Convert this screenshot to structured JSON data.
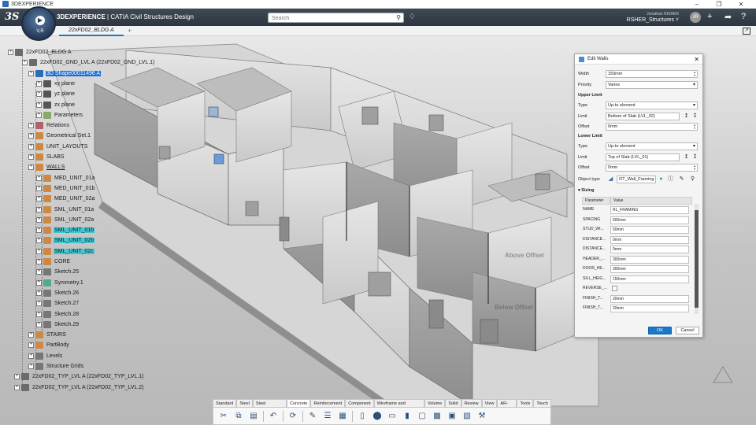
{
  "window": {
    "title": "3DEXPERIENCE",
    "minimize": "–",
    "maximize": "❐",
    "close": "✕"
  },
  "header": {
    "brand_prefix": "3DEXPERIENCE",
    "brand_suffix": " | CATIA Civil Structures Design",
    "search_placeholder": "Search",
    "user_name": "Jonathan RISHER",
    "space": "RSHER_Structures ˅",
    "avatar": "JR",
    "compass_label": "V,R"
  },
  "tabs": {
    "active": "22xFD02_BLDG A",
    "plus": "+"
  },
  "tree": [
    {
      "label": "22xFD02_BLDG A",
      "style": ""
    },
    {
      "label": "22xFD02_GND_LVL A (22xFD02_GND_LVL.1)",
      "style": ""
    },
    {
      "label": "3D Shape00011496 A",
      "style": "sel"
    },
    {
      "label": "xy plane",
      "style": ""
    },
    {
      "label": "yz plane",
      "style": ""
    },
    {
      "label": "zx plane",
      "style": ""
    },
    {
      "label": "Parameters",
      "style": ""
    },
    {
      "label": "Relations",
      "style": ""
    },
    {
      "label": "Geometrical Set.1",
      "style": ""
    },
    {
      "label": "UNIT_LAYOUTS",
      "style": ""
    },
    {
      "label": "SLABS",
      "style": ""
    },
    {
      "label": "WALLS",
      "style": "ul"
    },
    {
      "label": "MED_UNIT_01a",
      "style": ""
    },
    {
      "label": "MED_UNIT_01b",
      "style": ""
    },
    {
      "label": "MED_UNIT_02a",
      "style": ""
    },
    {
      "label": "SML_UNIT_01a",
      "style": ""
    },
    {
      "label": "SML_UNIT_02a",
      "style": ""
    },
    {
      "label": "SML_UNIT_01b",
      "style": "hl"
    },
    {
      "label": "SML_UNIT_02b",
      "style": "hl"
    },
    {
      "label": "SML_UNIT_02c",
      "style": "hl"
    },
    {
      "label": "CORE",
      "style": ""
    },
    {
      "label": "Sketch.25",
      "style": ""
    },
    {
      "label": "Symmetry.1",
      "style": ""
    },
    {
      "label": "Sketch.26",
      "style": ""
    },
    {
      "label": "Sketch.27",
      "style": ""
    },
    {
      "label": "Sketch.28",
      "style": ""
    },
    {
      "label": "Sketch.29",
      "style": ""
    },
    {
      "label": "STAIRS",
      "style": ""
    },
    {
      "label": "PartBody",
      "style": ""
    },
    {
      "label": "Levels",
      "style": ""
    },
    {
      "label": "Structure Grids",
      "style": ""
    },
    {
      "label": "22xFD02_TYP_LVL A (22xFD02_TYP_LVL.1)",
      "style": ""
    },
    {
      "label": "22xFD02_TYP_LVL A (22xFD02_TYP_LVL.2)",
      "style": ""
    }
  ],
  "viewport_labels": {
    "above": "Above Offset",
    "below": "Below Offset"
  },
  "dialog": {
    "title": "Edit Walls",
    "width_label": "Width",
    "width_value": "150mm",
    "priority_label": "Priority",
    "priority_value": "Varies",
    "upper_limit": "Upper Limit",
    "upper_type_label": "Type",
    "upper_type_value": "Up-to element",
    "upper_limit_label": "Limit",
    "upper_limit_value": "Bottom of Slab (LVL_02)",
    "upper_offset_label": "Offset",
    "upper_offset_value": "0mm",
    "lower_limit": "Lower Limit",
    "lower_type_label": "Type",
    "lower_type_value": "Up-to element",
    "lower_limit_label": "Limit",
    "lower_limit_value": "Top of Slab (LVL_01)",
    "lower_offset_label": "Offset",
    "lower_offset_value": "0mm",
    "object_type_label": "Object type",
    "object_type_value": "OT_Wall_Framing",
    "sizing": "▾ Sizing",
    "col_param": "Parameter",
    "col_value": "Value",
    "rows": [
      {
        "name": "NAME",
        "value": "RL_FRAMING"
      },
      {
        "name": "SPACING",
        "value": "600mm"
      },
      {
        "name": "STUD_WI...",
        "value": "50mm"
      },
      {
        "name": "DISTANCE...",
        "value": "0mm"
      },
      {
        "name": "DISTANCE...",
        "value": "0mm"
      },
      {
        "name": "HEADER_...",
        "value": "300mm"
      },
      {
        "name": "DOOR_HE...",
        "value": "300mm"
      },
      {
        "name": "SILL_HEIG...",
        "value": "150mm"
      },
      {
        "name": "REVERSE_...",
        "value": ""
      },
      {
        "name": "FINISH_T...",
        "value": "20mm"
      },
      {
        "name": "FINISH_T...",
        "value": "20mm"
      }
    ],
    "ok": "OK",
    "cancel": "Cancel"
  },
  "actionbar": {
    "tabs": [
      "Standard",
      "Steel",
      "Steel Detailing",
      "Concrete",
      "Reinforcement",
      "Component",
      "Wireframe and Surface",
      "Volume",
      "Solid",
      "Review",
      "View",
      "AR-VR",
      "Tools",
      "Touch"
    ],
    "active_tab": "Concrete"
  },
  "colors": {
    "header": "#2c3540",
    "accent": "#1a77c9",
    "selection": "#1a6fd6",
    "highlight": "#42c7d1"
  }
}
